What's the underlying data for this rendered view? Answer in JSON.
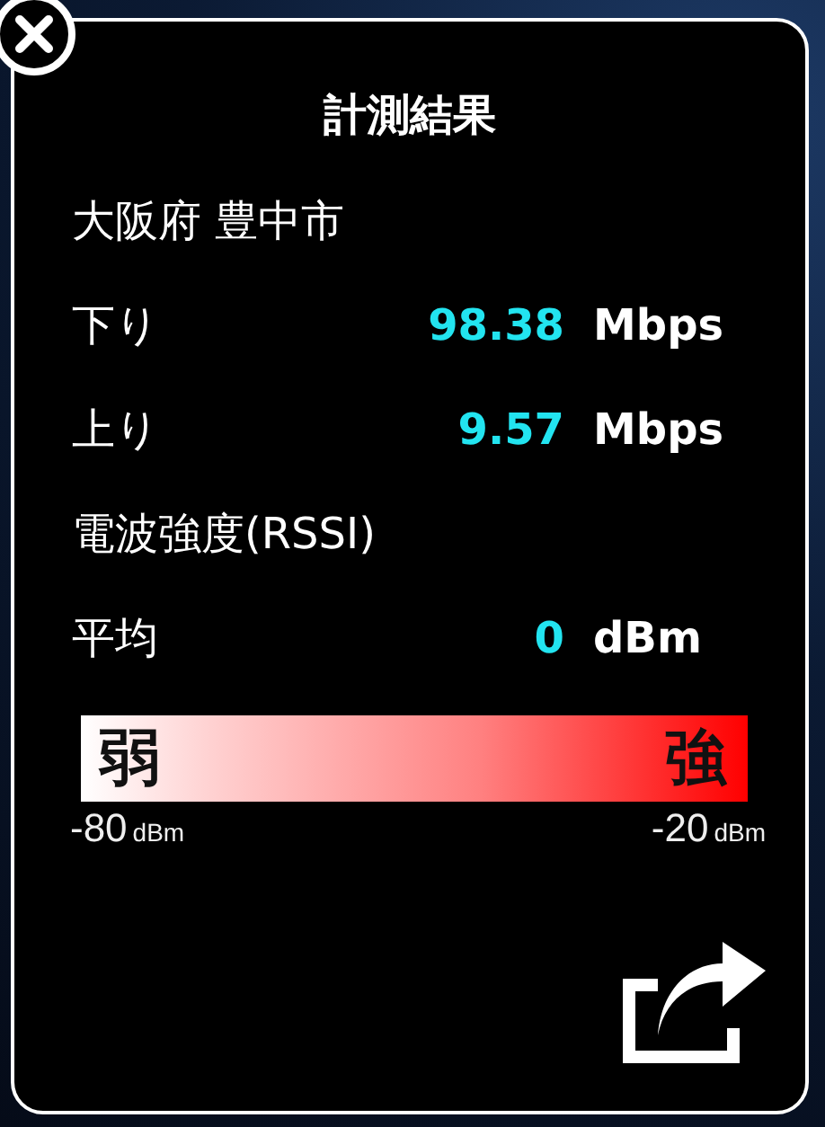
{
  "title": "計測結果",
  "rows": [
    {
      "kind": "text",
      "label": "大阪府 豊中市"
    },
    {
      "kind": "measure",
      "label": "下り",
      "value": "98.38",
      "unit": "Mbps"
    },
    {
      "kind": "measure",
      "label": "上り",
      "value": "9.57",
      "unit": "Mbps"
    },
    {
      "kind": "text",
      "label": "電波強度(RSSI)"
    },
    {
      "kind": "measure",
      "label": "平均",
      "value": "0",
      "unit": "dBm"
    }
  ],
  "scale": {
    "weak_label": "弱",
    "strong_label": "強",
    "min_value": "-80",
    "min_unit": "dBm",
    "max_value": "-20",
    "max_unit": "dBm"
  }
}
